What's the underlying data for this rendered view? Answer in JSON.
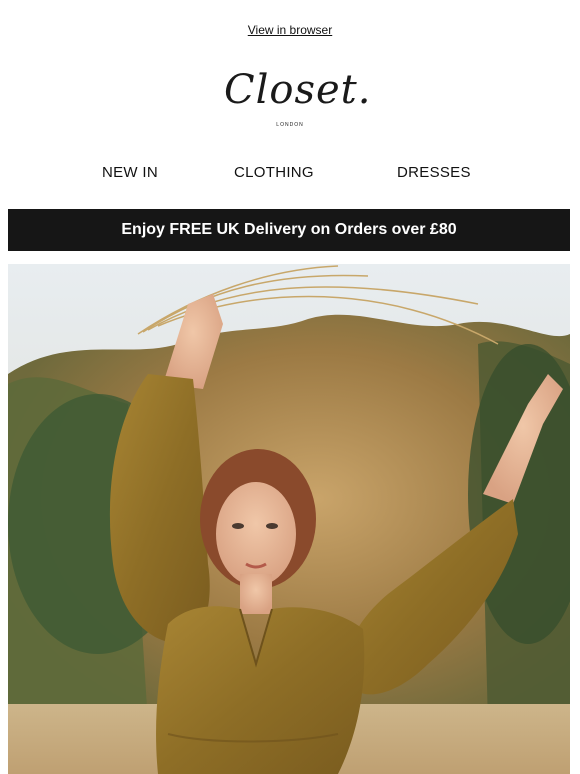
{
  "header": {
    "view_in_browser": "View in browser"
  },
  "logo": {
    "wordmark": "Closet.",
    "sub": "LONDON"
  },
  "nav": {
    "items": [
      {
        "label": "NEW IN"
      },
      {
        "label": "CLOTHING"
      },
      {
        "label": "DRESSES"
      }
    ]
  },
  "banner": {
    "text": "Enjoy FREE UK Delivery on Orders over £80"
  },
  "colors": {
    "banner_bg": "#161616",
    "banner_text": "#ffffff",
    "dress": "#9a7a2e"
  }
}
